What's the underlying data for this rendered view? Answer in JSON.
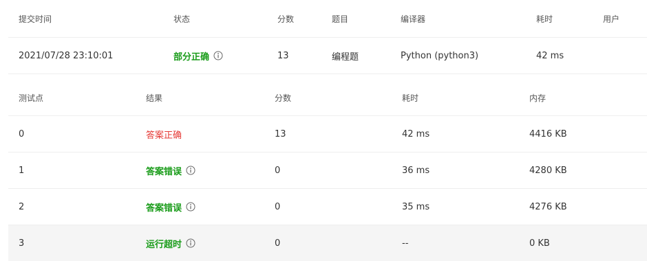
{
  "summary": {
    "headers": {
      "submit_time": "提交时间",
      "status": "状态",
      "score": "分数",
      "problem": "题目",
      "compiler": "编译器",
      "time": "耗时",
      "user": "用户"
    },
    "row": {
      "submit_time": "2021/07/28 23:10:01",
      "status": "部分正确",
      "score": "13",
      "problem": "编程题",
      "compiler": "Python (python3)",
      "time": "42 ms"
    }
  },
  "cases": {
    "headers": {
      "test_point": "测试点",
      "result": "结果",
      "score": "分数",
      "time": "耗时",
      "memory": "内存"
    },
    "rows": [
      {
        "id": "0",
        "result": "答案正确",
        "score": "13",
        "time": "42 ms",
        "memory": "4416 KB"
      },
      {
        "id": "1",
        "result": "答案错误",
        "score": "0",
        "time": "36 ms",
        "memory": "4280 KB"
      },
      {
        "id": "2",
        "result": "答案错误",
        "score": "0",
        "time": "35 ms",
        "memory": "4276 KB"
      },
      {
        "id": "3",
        "result": "运行超时",
        "score": "0",
        "time": "--",
        "memory": "0 KB"
      }
    ]
  },
  "colors": {
    "status_ok_green": "#1a9c1a",
    "status_accepted_red": "#e53935",
    "highlight_row_bg": "#f5f5f5"
  },
  "icons": {
    "info": "info-circle-icon"
  }
}
